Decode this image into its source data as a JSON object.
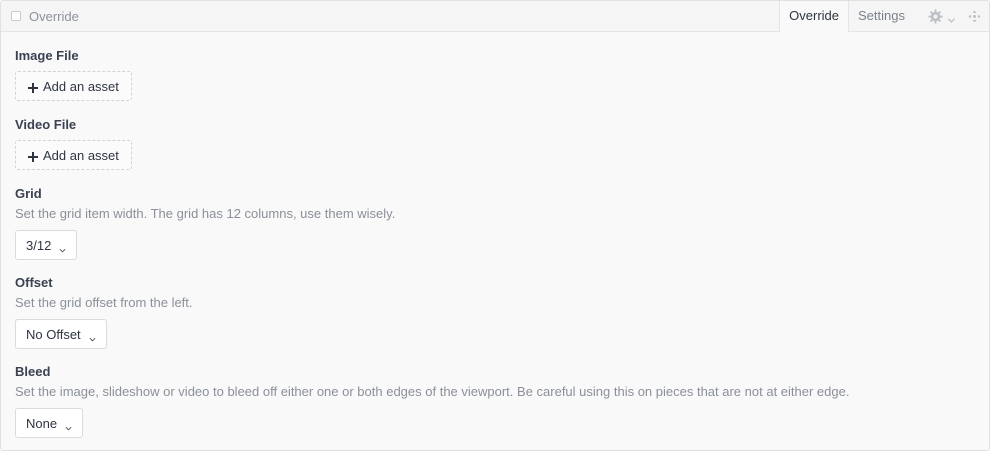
{
  "header": {
    "title": "Override",
    "tabs": [
      {
        "label": "Override",
        "active": true
      },
      {
        "label": "Settings",
        "active": false
      }
    ]
  },
  "fields": {
    "image_file": {
      "label": "Image File",
      "button": "Add an asset"
    },
    "video_file": {
      "label": "Video File",
      "button": "Add an asset"
    },
    "grid": {
      "label": "Grid",
      "help": "Set the grid item width. The grid has 12 columns, use them wisely.",
      "value": "3/12"
    },
    "offset": {
      "label": "Offset",
      "help": "Set the grid offset from the left.",
      "value": "No Offset"
    },
    "bleed": {
      "label": "Bleed",
      "help": "Set the image, slideshow or video to bleed off either one or both edges of the viewport. Be careful using this on pieces that are not at either edge.",
      "value": "None"
    }
  },
  "icons": {
    "checkbox": "checkbox-icon",
    "gear": "gear-icon",
    "chevron": "chevron-down-icon",
    "move": "move-icon",
    "plus": "plus-icon"
  }
}
